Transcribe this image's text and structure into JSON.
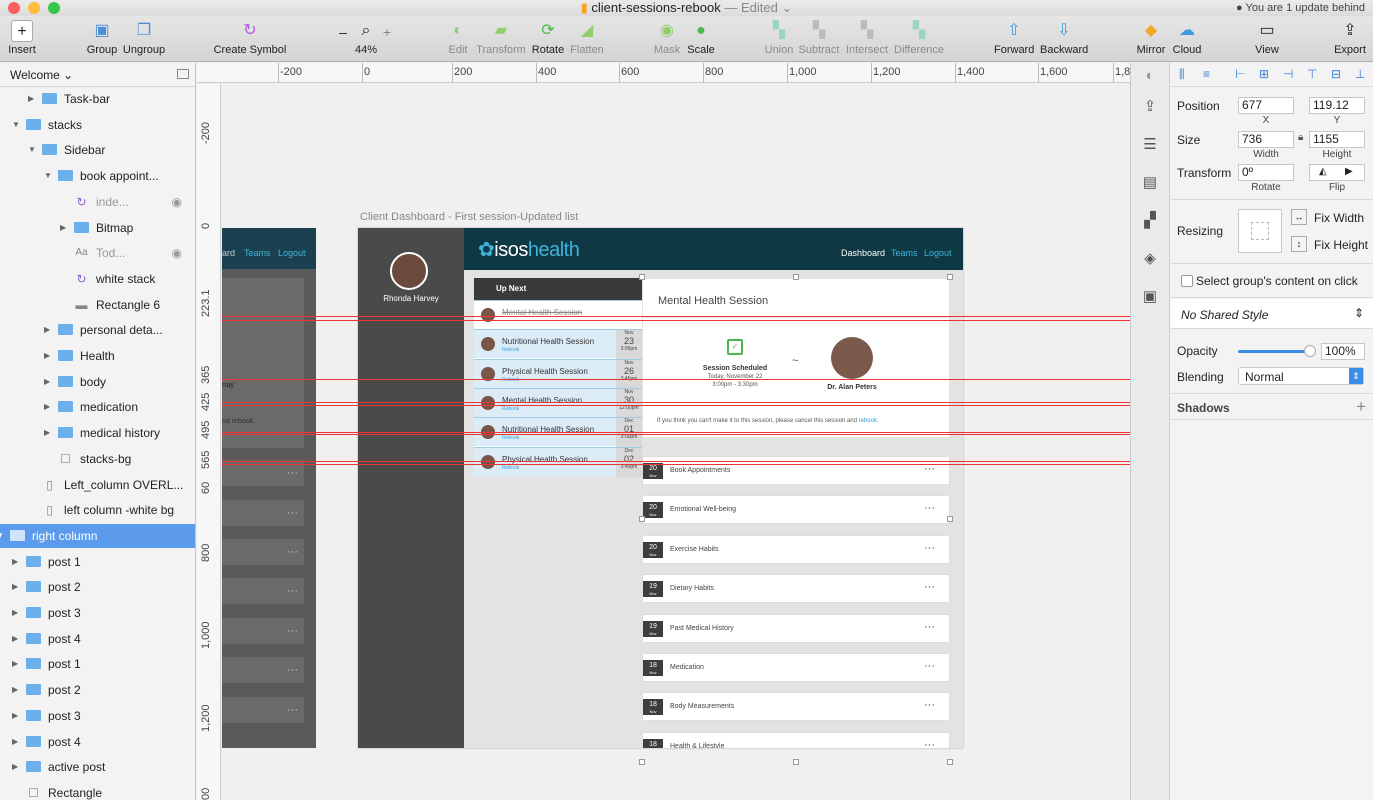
{
  "window": {
    "title": "client-sessions-rebook",
    "edited_label": "— Edited",
    "update_notice": "● You are 1 update behind"
  },
  "toolbar": {
    "insert": "Insert",
    "group": "Group",
    "ungroup": "Ungroup",
    "create_symbol": "Create Symbol",
    "zoom_minus": "–",
    "zoom_plus": "+",
    "zoom_level": "44%",
    "edit": "Edit",
    "transform": "Transform",
    "rotate": "Rotate",
    "flatten": "Flatten",
    "mask": "Mask",
    "scale": "Scale",
    "union": "Union",
    "subtract": "Subtract",
    "intersect": "Intersect",
    "difference": "Difference",
    "forward": "Forward",
    "backward": "Backward",
    "mirror": "Mirror",
    "cloud": "Cloud",
    "view": "View",
    "export": "Export"
  },
  "layers": {
    "page_name": "Welcome",
    "items": [
      "Task-bar",
      "stacks",
      "Sidebar",
      "book appoint...",
      "inde...",
      "Bitmap",
      "Tod...",
      "white stack",
      "Rectangle 6",
      "personal deta...",
      "Health",
      "body",
      "medication",
      "medical history",
      "stacks-bg",
      "Left_column OVERL...",
      "left column -white bg",
      "right column",
      "post 1",
      "post 2",
      "post 3",
      "post 4",
      "post 1",
      "post 2",
      "post 3",
      "post 4",
      "active post",
      "Rectangle"
    ]
  },
  "rulers": {
    "top": [
      "-200",
      "0",
      "200",
      "400",
      "600",
      "800",
      "1,000",
      "1,200",
      "1,400",
      "1,600",
      "1,8"
    ],
    "left": [
      "-200",
      "0",
      "223.1",
      "365",
      "425",
      "495",
      "565",
      "60",
      "800",
      "1,000",
      "1,200",
      "00"
    ]
  },
  "canvas": {
    "artboard_label": "Client Dashboard - First session-Updated list",
    "ghost": {
      "partial_nav": [
        "ard",
        "Teams",
        "Logout"
      ],
      "partial_name": "rray",
      "partial_rebook": "nd rebook.",
      "dots": "···"
    },
    "dashboard": {
      "user_name": "Rhonda Harvey",
      "logo_main": "isos",
      "logo_accent": "health",
      "nav": [
        "Dashboard",
        "Teams",
        "Logout"
      ],
      "up_next_title": "Up Next",
      "rebook_label": "Rebook",
      "up_next": [
        {
          "title": "Mental Health Session",
          "month": "",
          "day": "",
          "time": ""
        },
        {
          "title": "Nutritional Health Session",
          "month": "Nov",
          "day": "23",
          "time": "3:00pm"
        },
        {
          "title": "Physical Health Session",
          "month": "Nov",
          "day": "26",
          "time": "3:45pm"
        },
        {
          "title": "Mental Health Session",
          "month": "Nov",
          "day": "30",
          "time": "12:00pm"
        },
        {
          "title": "Nutritional Health Session",
          "month": "Dec",
          "day": "01",
          "time": "3:00pm"
        },
        {
          "title": "Physical Health Session",
          "month": "Dec",
          "day": "02",
          "time": "3:45pm"
        }
      ],
      "session": {
        "title": "Mental Health Session",
        "status": "Session Scheduled",
        "date": "Today, November 22",
        "time": "3:00pm - 3:30pm",
        "tilde": "~",
        "doctor": "Dr. Alan Peters",
        "note": "If you think you can't make it to this session, please cancel this session and",
        "note_link": "rebook."
      },
      "posts": [
        {
          "day": "20",
          "month": "Nov",
          "title": "Book Appointments"
        },
        {
          "day": "20",
          "month": "Nov",
          "title": "Emotional Well-being"
        },
        {
          "day": "20",
          "month": "Nov",
          "title": "Exercise Habits"
        },
        {
          "day": "19",
          "month": "Nov",
          "title": "Dietary Habits"
        },
        {
          "day": "19",
          "month": "Nov",
          "title": "Past Medical History"
        },
        {
          "day": "18",
          "month": "Nov",
          "title": "Medication"
        },
        {
          "day": "18",
          "month": "Nov",
          "title": "Body Measurements"
        },
        {
          "day": "18",
          "month": "Nov",
          "title": "Health & Lifestyle"
        }
      ],
      "post_dots": "···"
    }
  },
  "inspector": {
    "position_label": "Position",
    "x": "677",
    "y": "119.12",
    "x_label": "X",
    "y_label": "Y",
    "size_label": "Size",
    "width": "736",
    "height": "1155",
    "width_label": "Width",
    "height_label": "Height",
    "transform_label": "Transform",
    "rotate_value": "0º",
    "rotate_label": "Rotate",
    "flip_label": "Flip",
    "resizing_label": "Resizing",
    "fix_width": "Fix Width",
    "fix_height": "Fix Height",
    "select_group_content": "Select group's content on click",
    "shared_style": "No Shared Style",
    "opacity_label": "Opacity",
    "opacity_value": "100%",
    "opacity_fraction": 1.0,
    "blending_label": "Blending",
    "blending_value": "Normal",
    "shadows_label": "Shadows",
    "add_symbol": "+"
  },
  "colors": {
    "selection": "#5c9bec",
    "guide": "#ee3333",
    "header": "#0e3844",
    "accent": "#3fb3d8"
  }
}
